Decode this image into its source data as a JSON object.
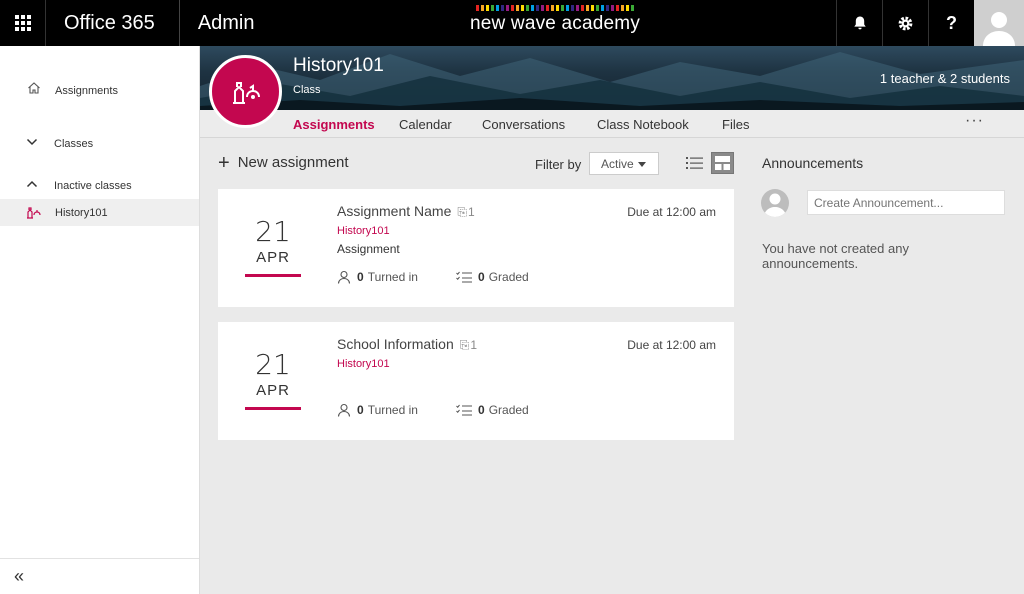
{
  "topbar": {
    "brand": "Office 365",
    "section": "Admin",
    "school_name": "new wave academy",
    "school_bar_colors": [
      "#e52521",
      "#f7a823",
      "#ffdd00",
      "#3aaa35",
      "#009fe3",
      "#312783",
      "#951b81",
      "#e52521",
      "#f7a823",
      "#ffdd00",
      "#3aaa35",
      "#009fe3",
      "#312783",
      "#951b81",
      "#e52521",
      "#f7a823",
      "#ffdd00",
      "#3aaa35",
      "#009fe3",
      "#312783",
      "#951b81",
      "#e52521",
      "#f7a823",
      "#ffdd00",
      "#3aaa35",
      "#009fe3",
      "#312783",
      "#951b81",
      "#e52521",
      "#f7a823",
      "#ffdd00",
      "#3aaa35"
    ],
    "icons": [
      "bell-icon",
      "gear-icon",
      "help-icon"
    ],
    "help_label": "?"
  },
  "sidebar": {
    "items": [
      {
        "label": "Assignments",
        "icon": "home-icon"
      },
      {
        "label": "Classes",
        "icon": "chevron-down-icon"
      },
      {
        "label": "Inactive classes",
        "icon": "chevron-up-icon"
      },
      {
        "label": "History101",
        "icon": "class-icon"
      }
    ],
    "collapse_label": "«"
  },
  "class": {
    "name": "History101",
    "subtitle": "Class",
    "members": "1 teacher & 2 students"
  },
  "tabs": [
    {
      "label": "Assignments",
      "active": true
    },
    {
      "label": "Calendar",
      "active": false
    },
    {
      "label": "Conversations",
      "active": false
    },
    {
      "label": "Class Notebook",
      "active": false
    },
    {
      "label": "Files",
      "active": false
    }
  ],
  "tabs_more": "···",
  "toolbar": {
    "new_assignment": "New assignment",
    "new_assignment_icon": "+",
    "filter_label": "Filter by",
    "filter_value": "Active"
  },
  "assignments": [
    {
      "day": "21",
      "month": "APR",
      "name": "Assignment Name",
      "attachments": "1",
      "class": "History101",
      "type": "Assignment",
      "due": "Due at 12:00 am",
      "turned_in_count": "0",
      "turned_in_label": "Turned in",
      "graded_count": "0",
      "graded_label": "Graded"
    },
    {
      "day": "21",
      "month": "APR",
      "name": "School Information",
      "attachments": "1",
      "class": "History101",
      "type": "",
      "due": "Due at 12:00 am",
      "turned_in_count": "0",
      "turned_in_label": "Turned in",
      "graded_count": "0",
      "graded_label": "Graded"
    }
  ],
  "announcements": {
    "title": "Announcements",
    "input_placeholder": "Create Announcement...",
    "empty_text": "You have not created any announcements."
  },
  "colors": {
    "accent": "#c3074f",
    "topbar": "#000000",
    "background": "#eaeaea"
  }
}
